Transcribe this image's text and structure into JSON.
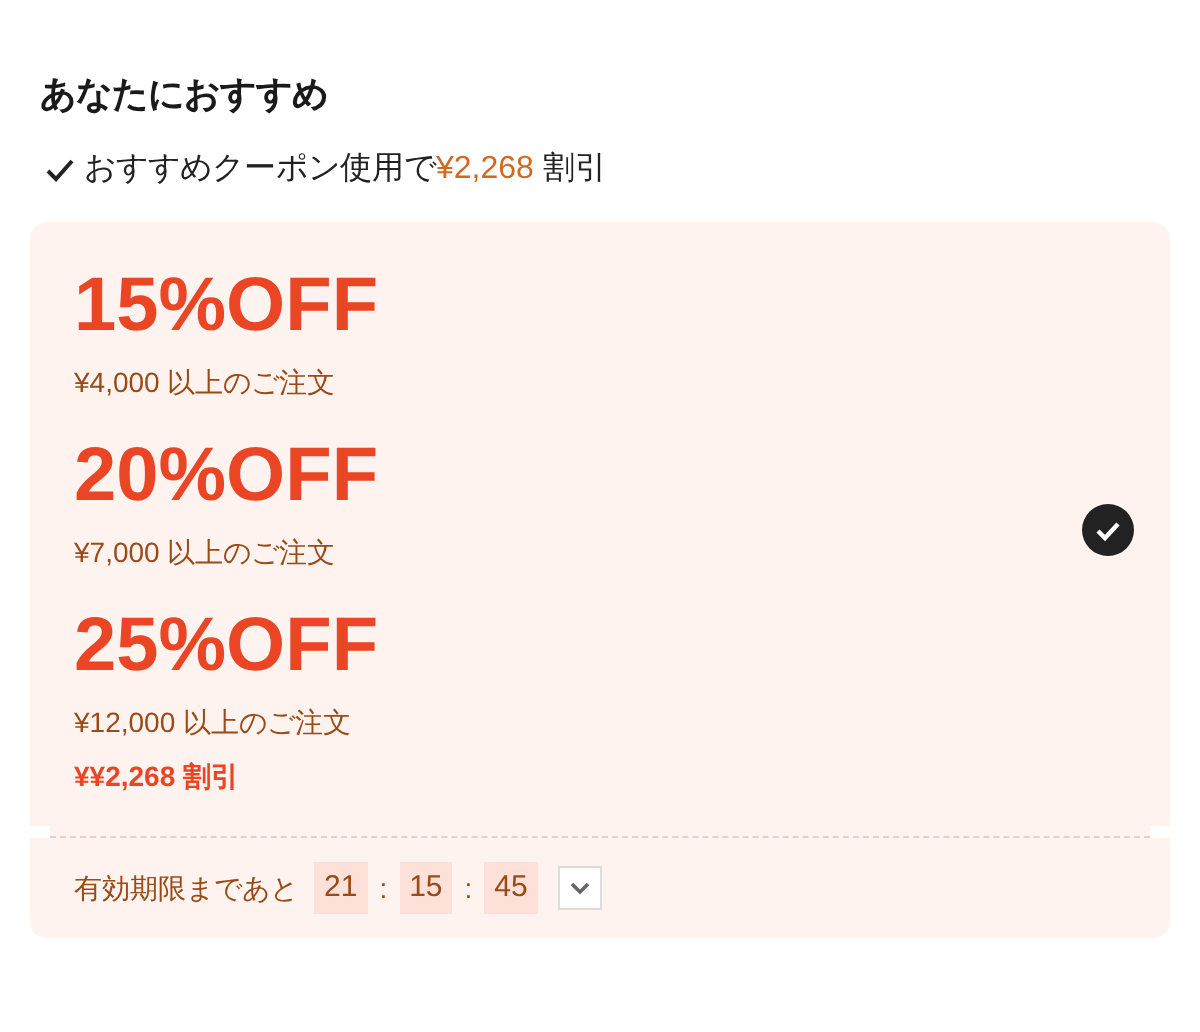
{
  "title": "あなたにおすすめ",
  "summary": {
    "text": "おすすめクーポン使用で",
    "amount": "¥2,268",
    "suffix": "割引"
  },
  "coupon_bundle": {
    "selected": true,
    "coupons": [
      {
        "discount": "15%OFF",
        "condition": "¥4,000 以上のご注文"
      },
      {
        "discount": "20%OFF",
        "condition": "¥7,000 以上のご注文"
      },
      {
        "discount": "25%OFF",
        "condition": "¥12,000 以上のご注文"
      }
    ],
    "saving": "¥¥2,268 割引"
  },
  "expiry": {
    "label": "有効期限まであと",
    "timer": [
      "21",
      ":",
      "15",
      ":",
      "45"
    ],
    "expanded": false
  }
}
